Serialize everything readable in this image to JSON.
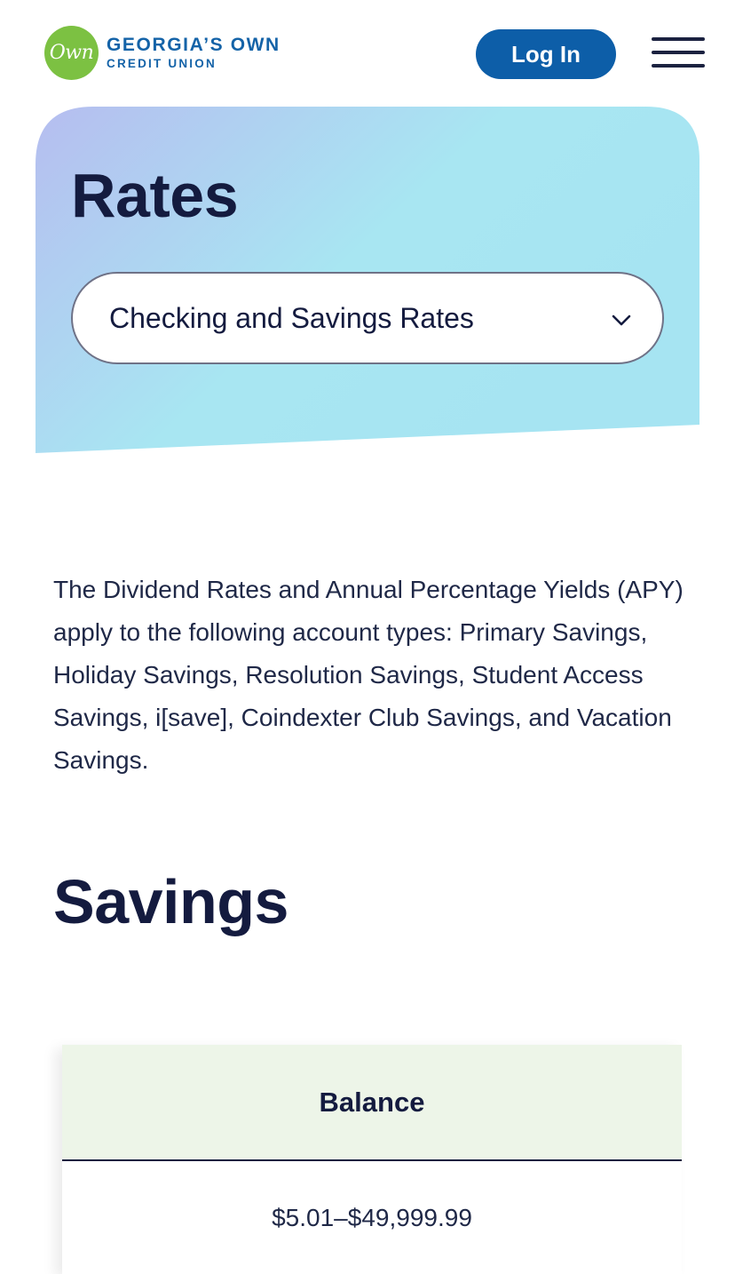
{
  "header": {
    "logo_mark": "Own",
    "logo_line1": "GEORGIA’S OWN",
    "logo_line2": "CREDIT UNION",
    "login_label": "Log In",
    "menu_icon": "hamburger-menu-icon"
  },
  "hero": {
    "title": "Rates",
    "select_value": "Checking and Savings Rates",
    "select_icon": "chevron-down-icon",
    "gradient_colors": [
      "#b6bdf0",
      "#a8e6f2"
    ]
  },
  "intro_text": "The Dividend Rates and Annual Percentage Yields (APY) apply to the following account types: Primary Savings, Holiday Savings, Resolution Savings, Student Access Savings, i[save], Coindexter Club Savings, and Vacation Savings.",
  "savings": {
    "title": "Savings",
    "table": {
      "header": "Balance",
      "rows": [
        "$5.01–$49,999.99"
      ]
    }
  },
  "colors": {
    "brand_blue": "#0d5ea8",
    "brand_green": "#7cc142",
    "navy_text": "#141b3f",
    "table_header_bg": "#edf5e8"
  }
}
